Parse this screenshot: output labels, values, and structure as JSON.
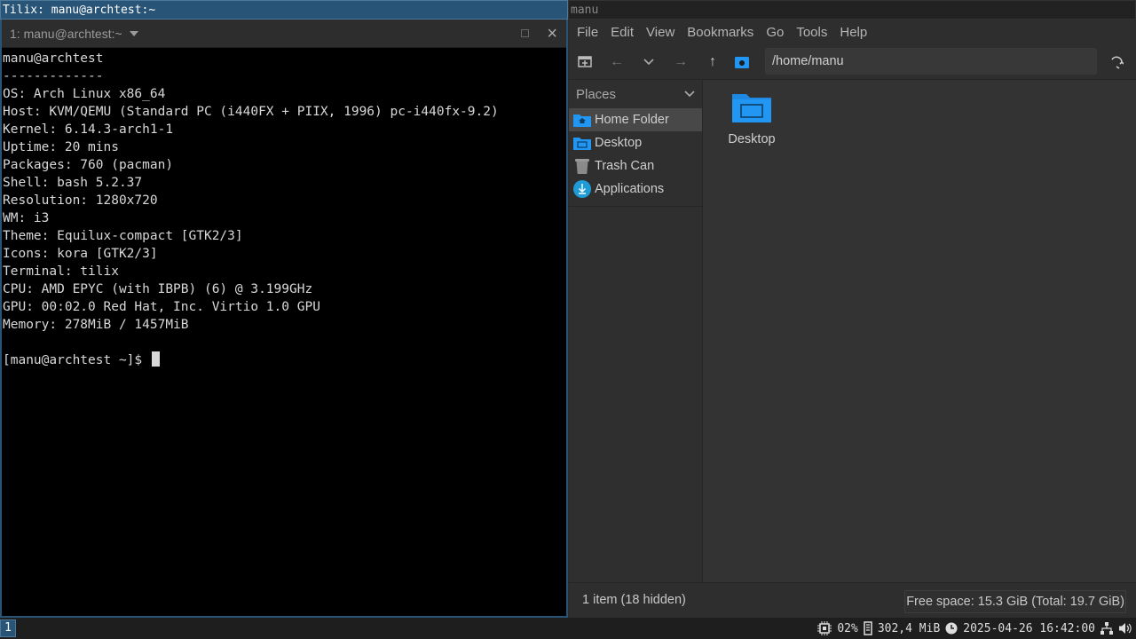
{
  "i3": {
    "terminal_title": "Tilix: manu@archtest:~",
    "filemanager_title": "manu"
  },
  "tilix": {
    "session_title": "1: manu@archtest:~",
    "terminal_lines": [
      "manu@archtest",
      "-------------",
      "OS: Arch Linux x86_64",
      "Host: KVM/QEMU (Standard PC (i440FX + PIIX, 1996) pc-i440fx-9.2)",
      "Kernel: 6.14.3-arch1-1",
      "Uptime: 20 mins",
      "Packages: 760 (pacman)",
      "Shell: bash 5.2.37",
      "Resolution: 1280x720",
      "WM: i3",
      "Theme: Equilux-compact [GTK2/3]",
      "Icons: kora [GTK2/3]",
      "Terminal: tilix",
      "CPU: AMD EPYC (with IBPB) (6) @ 3.199GHz",
      "GPU: 00:02.0 Red Hat, Inc. Virtio 1.0 GPU",
      "Memory: 278MiB / 1457MiB",
      ""
    ],
    "prompt": "[manu@archtest ~]$ "
  },
  "thunar": {
    "menu": [
      "File",
      "Edit",
      "View",
      "Bookmarks",
      "Go",
      "Tools",
      "Help"
    ],
    "path": "/home/manu",
    "places_label": "Places",
    "places": [
      {
        "label": "Home Folder",
        "icon": "home-folder-icon"
      },
      {
        "label": "Desktop",
        "icon": "desktop-folder-icon"
      },
      {
        "label": "Trash Can",
        "icon": "trash-icon"
      },
      {
        "label": "Applications",
        "icon": "applications-icon"
      }
    ],
    "items": [
      {
        "label": "Desktop",
        "icon": "folder-icon"
      }
    ],
    "status_left": "1 item (18 hidden)",
    "status_right": "Free space: 15.3 GiB (Total: 19.7 GiB)"
  },
  "i3bar": {
    "workspace": "1",
    "cpu": "02%",
    "memory": "302,4 MiB",
    "datetime": "2025-04-26 16:42:00"
  },
  "colors": {
    "accent": "#285577",
    "folder_blue": "#2196f3",
    "terminal_bg": "#000000"
  }
}
